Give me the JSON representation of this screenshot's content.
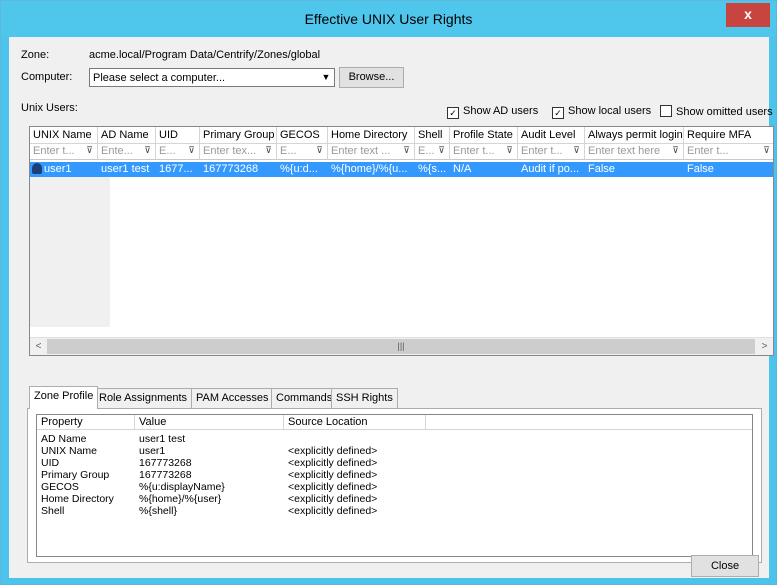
{
  "window": {
    "title": "Effective UNIX User Rights",
    "close_glyph": "x"
  },
  "zone": {
    "label": "Zone:",
    "value": "acme.local/Program Data/Centrify/Zones/global"
  },
  "computer": {
    "label": "Computer:",
    "placeholder": "Please select a computer...",
    "browse_label": "Browse..."
  },
  "unix_users_label": "Unix Users:",
  "options": {
    "show_ad_users": {
      "label": "Show AD users",
      "checked": true,
      "mark": "✓"
    },
    "show_local_users": {
      "label": "Show local users",
      "checked": true,
      "mark": "✓"
    },
    "show_omitted_users": {
      "label": "Show omitted users",
      "checked": false,
      "mark": ""
    }
  },
  "grid": {
    "columns": [
      "UNIX Name",
      "AD Name",
      "UID",
      "Primary Group",
      "GECOS",
      "Home Directory",
      "Shell",
      "Profile State",
      "Audit Level",
      "Always permit login",
      "Require MFA"
    ],
    "filters": [
      "Enter t...",
      "Ente...",
      "E...",
      "Enter tex...",
      "E...",
      "Enter text ...",
      "E...",
      "Enter t...",
      "Enter t...",
      "Enter text here",
      "Enter t..."
    ],
    "rows": [
      [
        "user1",
        "user1 test",
        "1677...",
        "167773268",
        "%{u:d...",
        "%{home}/%{u...",
        "%{s...",
        "N/A",
        "Audit if po...",
        "False",
        "False"
      ]
    ]
  },
  "tabs": [
    "Zone Profile",
    "Role Assignments",
    "PAM Accesses",
    "Commands",
    "SSH Rights"
  ],
  "profile_table": {
    "headers": [
      "Property",
      "Value",
      "Source Location"
    ],
    "rows": [
      [
        "AD Name",
        "user1 test",
        ""
      ],
      [
        "UNIX Name",
        "user1",
        "<explicitly defined>"
      ],
      [
        "UID",
        "167773268",
        "<explicitly defined>"
      ],
      [
        "Primary Group",
        "167773268",
        "<explicitly defined>"
      ],
      [
        "GECOS",
        "%{u:displayName}",
        "<explicitly defined>"
      ],
      [
        "Home Directory",
        "%{home}/%{user}",
        "<explicitly defined>"
      ],
      [
        "Shell",
        "%{shell}",
        "<explicitly defined>"
      ]
    ]
  },
  "footer": {
    "close_label": "Close"
  },
  "icons": {
    "filter": "filter-icon",
    "user": "user-icon",
    "scroll_left": "scroll-left-icon",
    "scroll_right": "scroll-right-icon",
    "dropdown": "chevron-down-icon"
  }
}
